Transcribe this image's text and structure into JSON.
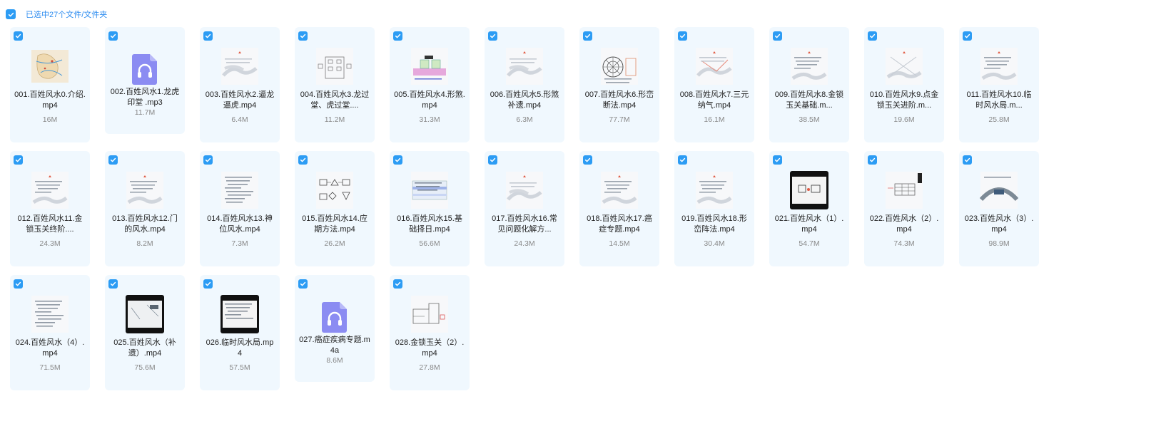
{
  "header": {
    "selection_text": "已选中27个文件/文件夹"
  },
  "files": [
    {
      "name": "001.百姓风水0.介绍.mp4",
      "size": "16M",
      "thumb": "map"
    },
    {
      "name": "002.百姓风水1.龙虎印堂 .mp3",
      "size": "11.7M",
      "thumb": "audio"
    },
    {
      "name": "003.百姓风水2.逼龙逼虎.mp4",
      "size": "6.4M",
      "thumb": "sketch"
    },
    {
      "name": "004.百姓风水3.龙过堂、虎过堂....",
      "size": "11.2M",
      "thumb": "boxes"
    },
    {
      "name": "005.百姓风水4.形煞.mp4",
      "size": "31.3M",
      "thumb": "diagram-color"
    },
    {
      "name": "006.百姓风水5.形煞补遗.mp4",
      "size": "6.3M",
      "thumb": "sketch"
    },
    {
      "name": "007.百姓风水6.形峦断法.mp4",
      "size": "77.7M",
      "thumb": "compass"
    },
    {
      "name": "008.百姓风水7.三元纳气.mp4",
      "size": "16.1M",
      "thumb": "sketch-red"
    },
    {
      "name": "009.百姓风水8.金锁玉关基础.m...",
      "size": "38.5M",
      "thumb": "sketch-text"
    },
    {
      "name": "010.百姓风水9.点金锁玉关进阶.m...",
      "size": "19.6M",
      "thumb": "sketch-lines"
    },
    {
      "name": "011.百姓风水10.临时风水局.m...",
      "size": "25.8M",
      "thumb": "sketch-text"
    },
    {
      "name": "012.百姓风水11.金锁玉关终阶....",
      "size": "24.3M",
      "thumb": "sketch-text"
    },
    {
      "name": "013.百姓风水12.门的风水.mp4",
      "size": "8.2M",
      "thumb": "sketch-text"
    },
    {
      "name": "014.百姓风水13.神位风水.mp4",
      "size": "7.3M",
      "thumb": "text-doc"
    },
    {
      "name": "015.百姓风水14.应期方法.mp4",
      "size": "26.2M",
      "thumb": "shapes"
    },
    {
      "name": "016.百姓风水15.基础择日.mp4",
      "size": "56.6M",
      "thumb": "table-color"
    },
    {
      "name": "017.百姓风水16.常见问题化解方...",
      "size": "24.3M",
      "thumb": "sketch"
    },
    {
      "name": "018.百姓风水17.癌症专题.mp4",
      "size": "14.5M",
      "thumb": "sketch-text"
    },
    {
      "name": "019.百姓风水18.形峦阵法.mp4",
      "size": "30.4M",
      "thumb": "sketch-text"
    },
    {
      "name": "021.百姓风水（1）.mp4",
      "size": "54.7M",
      "thumb": "black-frame"
    },
    {
      "name": "022.百姓风水（2）.mp4",
      "size": "74.3M",
      "thumb": "grid-doc"
    },
    {
      "name": "023.百姓风水（3）.mp4",
      "size": "98.9M",
      "thumb": "curve"
    },
    {
      "name": "024.百姓风水（4）.mp4",
      "size": "71.5M",
      "thumb": "text-doc"
    },
    {
      "name": "025.百姓风水（补遗）.mp4",
      "size": "75.6M",
      "thumb": "black-frame-light"
    },
    {
      "name": "026.临时风水局.mp4",
      "size": "57.5M",
      "thumb": "black-frame-text"
    },
    {
      "name": "027.癌症疾病专题.m4a",
      "size": "8.6M",
      "thumb": "audio"
    },
    {
      "name": "028.金锁玉关（2）.mp4",
      "size": "27.8M",
      "thumb": "floorplan"
    }
  ]
}
